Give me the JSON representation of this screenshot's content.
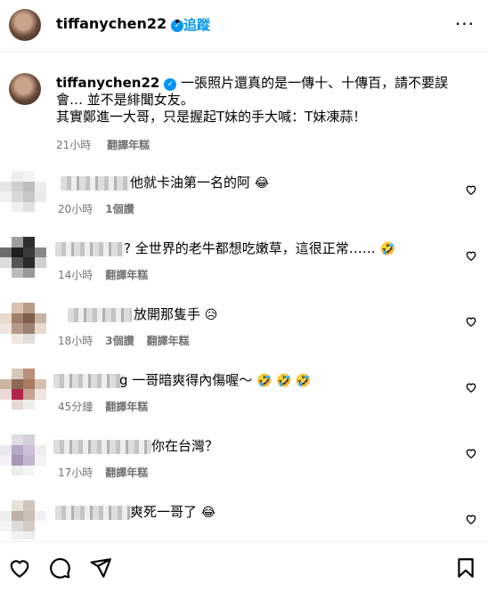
{
  "header": {
    "username": "tiffanychen22",
    "dot": "•",
    "follow_label": "追蹤",
    "more": "···"
  },
  "caption": {
    "username": "tiffanychen22",
    "line1": "一張照片還真的是一傳十、十傳百，請不要誤",
    "line2": "會… 並不是緋聞女友。",
    "line3": "其實鄭進一大哥，只是握起T妹的手大喊：T妹凍蒜！",
    "time": "21小時",
    "translate": "翻譯年糕"
  },
  "comments": [
    {
      "text": "他就卡油第一名的阿",
      "emoji": "😂",
      "time": "20小時",
      "likes": "1個讚",
      "translate": ""
    },
    {
      "text": "? 全世界的老牛都想吃嫩草，這很正常……",
      "emoji": "🤣",
      "time": "14小時",
      "likes": "",
      "translate": "翻譯年糕"
    },
    {
      "text": "放開那隻手",
      "emoji": "😥",
      "time": "18小時",
      "likes": "3個讚",
      "translate": "翻譯年糕"
    },
    {
      "text": "g 一哥暗爽得內傷喔～",
      "emoji": "🤣 🤣 🤣",
      "time": "45分鐘",
      "likes": "",
      "translate": "翻譯年糕"
    },
    {
      "text": "你在台灣？",
      "emoji": "",
      "time": "17小時",
      "likes": "",
      "translate": "翻譯年糕"
    },
    {
      "text": "爽死一哥了",
      "emoji": "😂",
      "time": "",
      "likes": "",
      "translate": ""
    }
  ],
  "icons": {
    "like": "heart-icon",
    "comment": "comment-icon",
    "share": "share-icon",
    "save": "bookmark-icon"
  },
  "colors": {
    "link": "#0095f6",
    "meta": "#737373"
  }
}
